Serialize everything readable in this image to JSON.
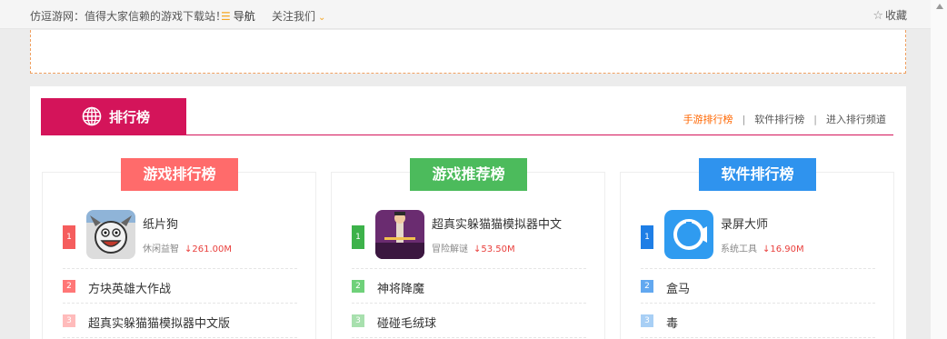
{
  "topbar": {
    "slogan": "仿逗游网：值得大家信赖的游戏下载站！",
    "nav_label": "导航",
    "follow_label": "关注我们",
    "favorite_label": "收藏"
  },
  "rank": {
    "tab_label": "排行榜",
    "links": [
      "手游排行榜",
      "软件排行榜",
      "进入排行频道"
    ]
  },
  "columns": [
    {
      "title": "游戏排行榜",
      "top": {
        "rank": "1",
        "name": "纸片狗",
        "category": "休闲益智",
        "size": "261.00M"
      },
      "items": [
        {
          "rank": "2",
          "name": "方块英雄大作战"
        },
        {
          "rank": "3",
          "name": "超真实躲猫猫模拟器中文版"
        }
      ]
    },
    {
      "title": "游戏推荐榜",
      "top": {
        "rank": "1",
        "name": "超真实躲猫猫模拟器中文",
        "category": "冒险解谜",
        "size": "53.50M"
      },
      "items": [
        {
          "rank": "2",
          "name": "神将降魔"
        },
        {
          "rank": "3",
          "name": "碰碰毛绒球"
        }
      ]
    },
    {
      "title": "软件排行榜",
      "top": {
        "rank": "1",
        "name": "录屏大师",
        "category": "系统工具",
        "size": "16.90M"
      },
      "items": [
        {
          "rank": "2",
          "name": "盒马"
        },
        {
          "rank": "3",
          "name": "毒"
        }
      ]
    }
  ],
  "colors": {
    "brand": "#d4145a",
    "accent": "#ff6600",
    "col1": "#ff6b6b",
    "col2": "#4cbb5c",
    "col3": "#2f93ee"
  }
}
